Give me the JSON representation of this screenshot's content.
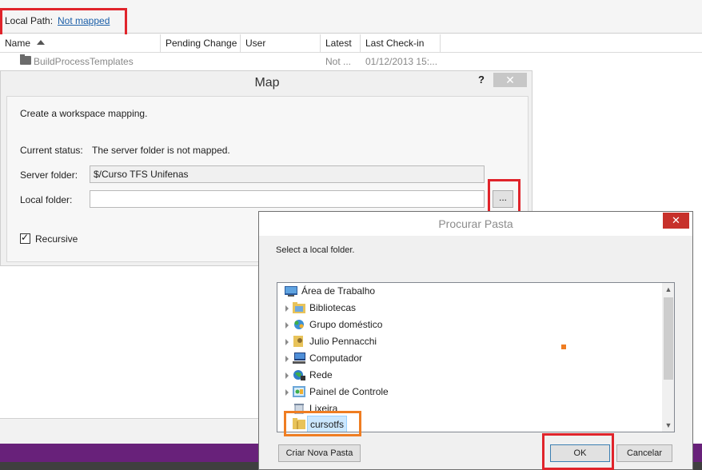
{
  "top": {
    "local_path_label": "Local Path:",
    "local_path_link": "Not mapped"
  },
  "columns": [
    "Name",
    "Pending Change",
    "User",
    "Latest",
    "Last Check-in"
  ],
  "rows": [
    {
      "name": "BuildProcessTemplates",
      "pending": "",
      "user": "",
      "latest": "Not ...",
      "last_checkin": "01/12/2013 15:..."
    }
  ],
  "map_dialog": {
    "title": "Map",
    "help": "?",
    "close": "✕",
    "intro": "Create a workspace mapping.",
    "status_label": "Current status:",
    "status_value": "The server folder is not mapped.",
    "server_label": "Server folder:",
    "server_value": "$/Curso TFS Unifenas",
    "local_label": "Local folder:",
    "local_value": "",
    "browse": "...",
    "recursive_label": "Recursive",
    "recursive_checked": true
  },
  "browse_dialog": {
    "title": "Procurar Pasta",
    "close": "✕",
    "instruction": "Select a local folder.",
    "tree": [
      {
        "label": "Área de Trabalho",
        "icon": "desktop-icon",
        "expandable": false
      },
      {
        "label": "Bibliotecas",
        "icon": "library-folder-icon",
        "expandable": true
      },
      {
        "label": "Grupo doméstico",
        "icon": "homegroup-icon",
        "expandable": true
      },
      {
        "label": "Julio Pennacchi",
        "icon": "user-folder-icon",
        "expandable": true
      },
      {
        "label": "Computador",
        "icon": "computer-icon",
        "expandable": true
      },
      {
        "label": "Rede",
        "icon": "network-icon",
        "expandable": true
      },
      {
        "label": "Painel de Controle",
        "icon": "control-panel-icon",
        "expandable": true
      },
      {
        "label": "Lixeira",
        "icon": "recycle-bin-icon",
        "expandable": false
      },
      {
        "label": "cursotfs",
        "icon": "folder-icon",
        "expandable": false,
        "selected": true
      }
    ],
    "new_folder": "Criar Nova Pasta",
    "ok": "OK",
    "cancel": "Cancelar"
  },
  "colors": {
    "highlight_red": "#e0242b",
    "highlight_orange": "#ef7d22",
    "vs_purple": "#68217a",
    "close_red": "#c7312b"
  }
}
